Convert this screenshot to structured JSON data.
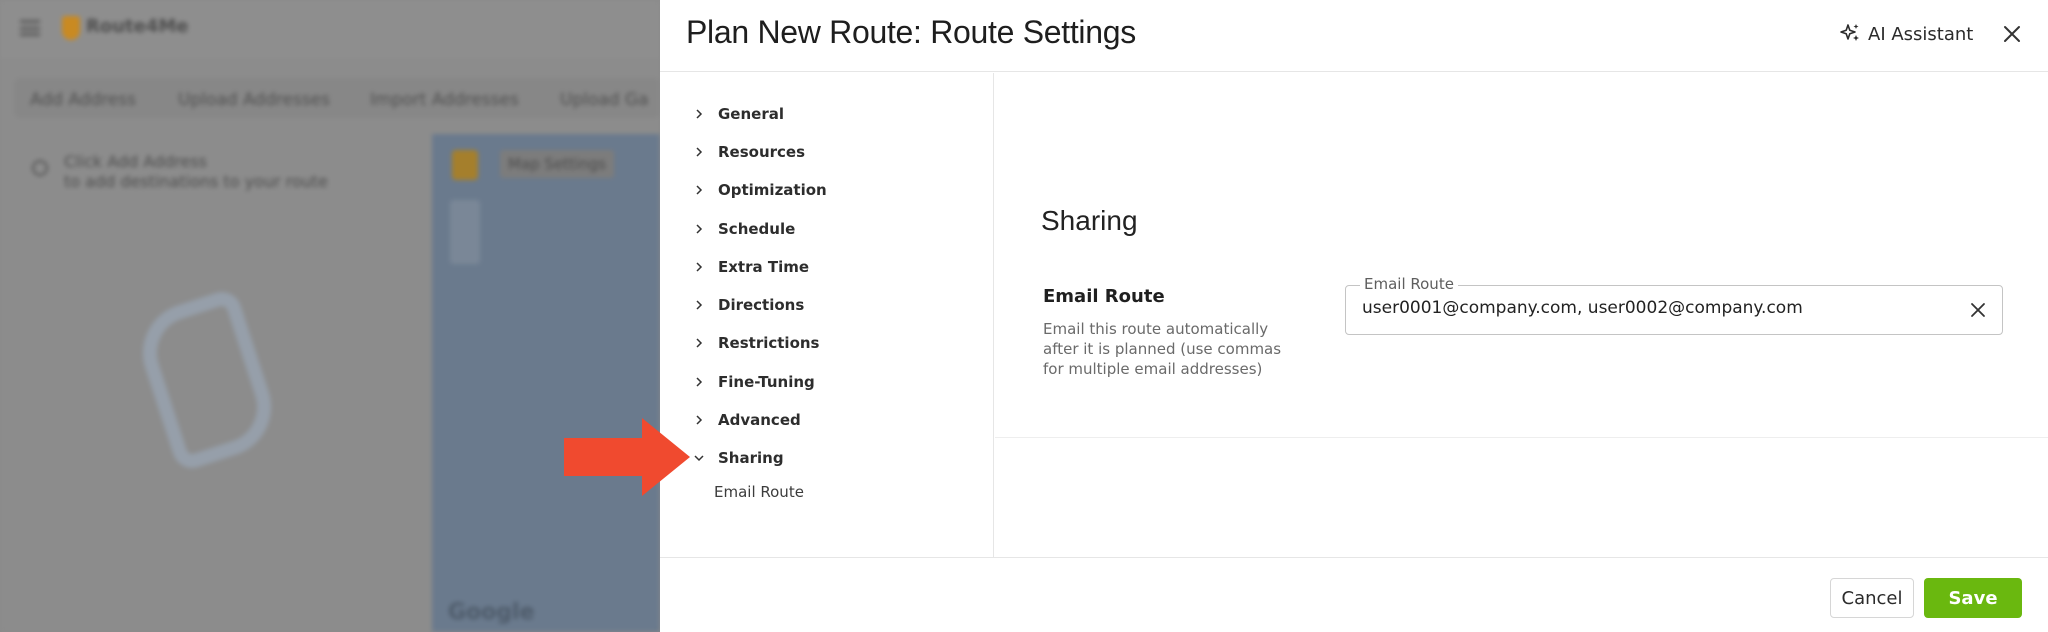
{
  "background_app": {
    "logo_text": "Route4Me",
    "toolbar": [
      "Add Address",
      "Upload Addresses",
      "Import Addresses",
      "Upload Ga"
    ],
    "hint_line1": "Click Add Address",
    "hint_line2": "to add destinations to your route",
    "map_settings_label": "Map Settings",
    "map_attribution": "Google"
  },
  "modal": {
    "title": "Plan New Route: Route Settings",
    "ai_assistant_label": "AI Assistant",
    "nav": [
      {
        "label": "General",
        "expanded": false
      },
      {
        "label": "Resources",
        "expanded": false
      },
      {
        "label": "Optimization",
        "expanded": false
      },
      {
        "label": "Schedule",
        "expanded": false
      },
      {
        "label": "Extra Time",
        "expanded": false
      },
      {
        "label": "Directions",
        "expanded": false
      },
      {
        "label": "Restrictions",
        "expanded": false
      },
      {
        "label": "Fine-Tuning",
        "expanded": false
      },
      {
        "label": "Advanced",
        "expanded": false
      },
      {
        "label": "Sharing",
        "expanded": true
      }
    ],
    "nav_sub_item": "Email Route",
    "section": {
      "title": "Sharing",
      "field_title": "Email Route",
      "field_description": "Email this route automatically after it is planned (use commas for multiple email addresses)",
      "input_legend": "Email Route",
      "input_value": "user0001@company.com, user0002@company.com"
    },
    "footer": {
      "cancel_label": "Cancel",
      "save_label": "Save"
    }
  },
  "colors": {
    "save_button": "#6ab80f",
    "annotation_arrow": "#f04a2f",
    "overlay": "#8c8c8c"
  }
}
